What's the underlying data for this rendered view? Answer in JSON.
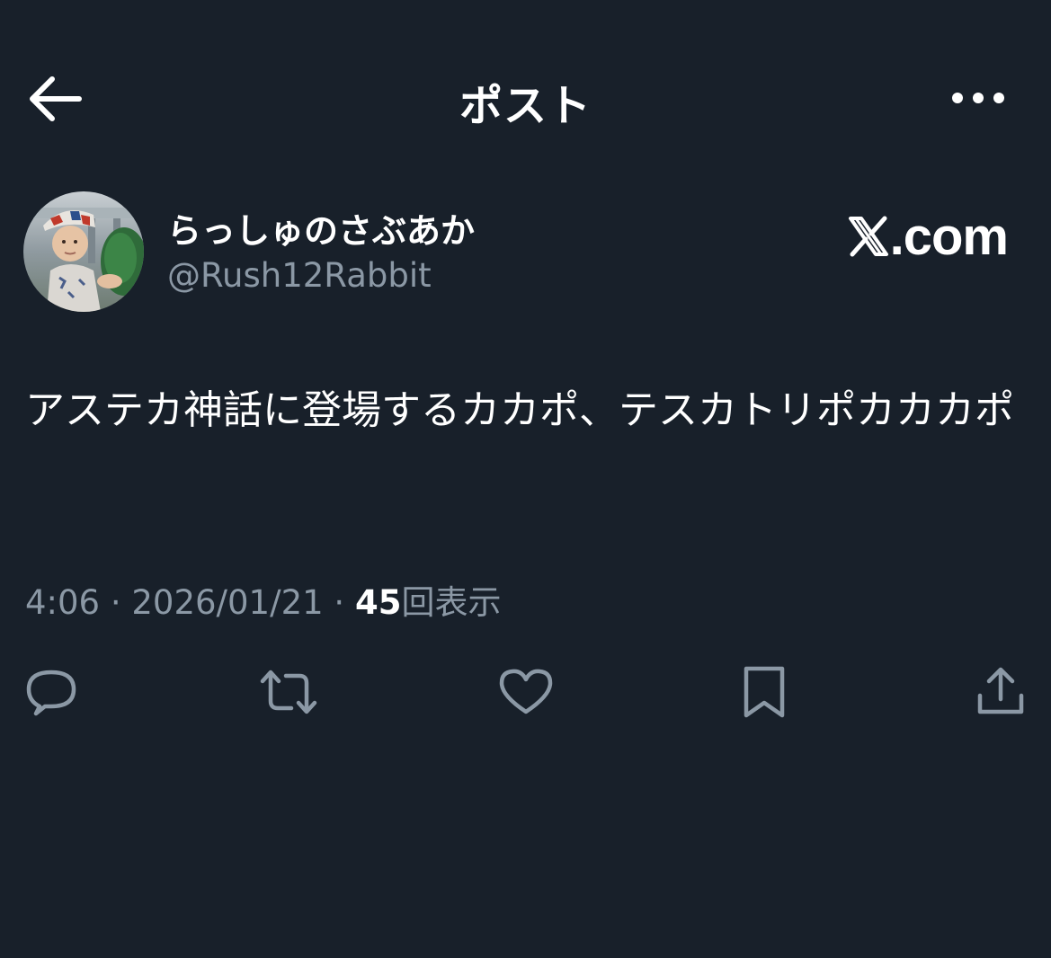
{
  "header": {
    "title": "ポスト",
    "back_icon": "arrow-left-icon",
    "more_icon": "more-horizontal-icon"
  },
  "author": {
    "display_name": "らっしゅのさぶあか",
    "handle": "@Rush12Rabbit",
    "avatar": "avatar-photo"
  },
  "brand": {
    "text": ".com",
    "icon": "x-logo-icon"
  },
  "post": {
    "text": "アステカ神話に登場するカカポ、テスカトリポカカカポ"
  },
  "meta": {
    "time": "4:06",
    "separator1": " · ",
    "date": "2026/01/21",
    "separator2": " · ",
    "views_count": "45",
    "views_label": "回表示"
  },
  "actions": {
    "reply_icon": "reply-icon",
    "repost_icon": "repost-icon",
    "like_icon": "heart-icon",
    "bookmark_icon": "bookmark-icon",
    "share_icon": "share-icon"
  },
  "colors": {
    "background": "#18202a",
    "text_primary": "#ffffff",
    "text_secondary": "#8b98a5"
  }
}
